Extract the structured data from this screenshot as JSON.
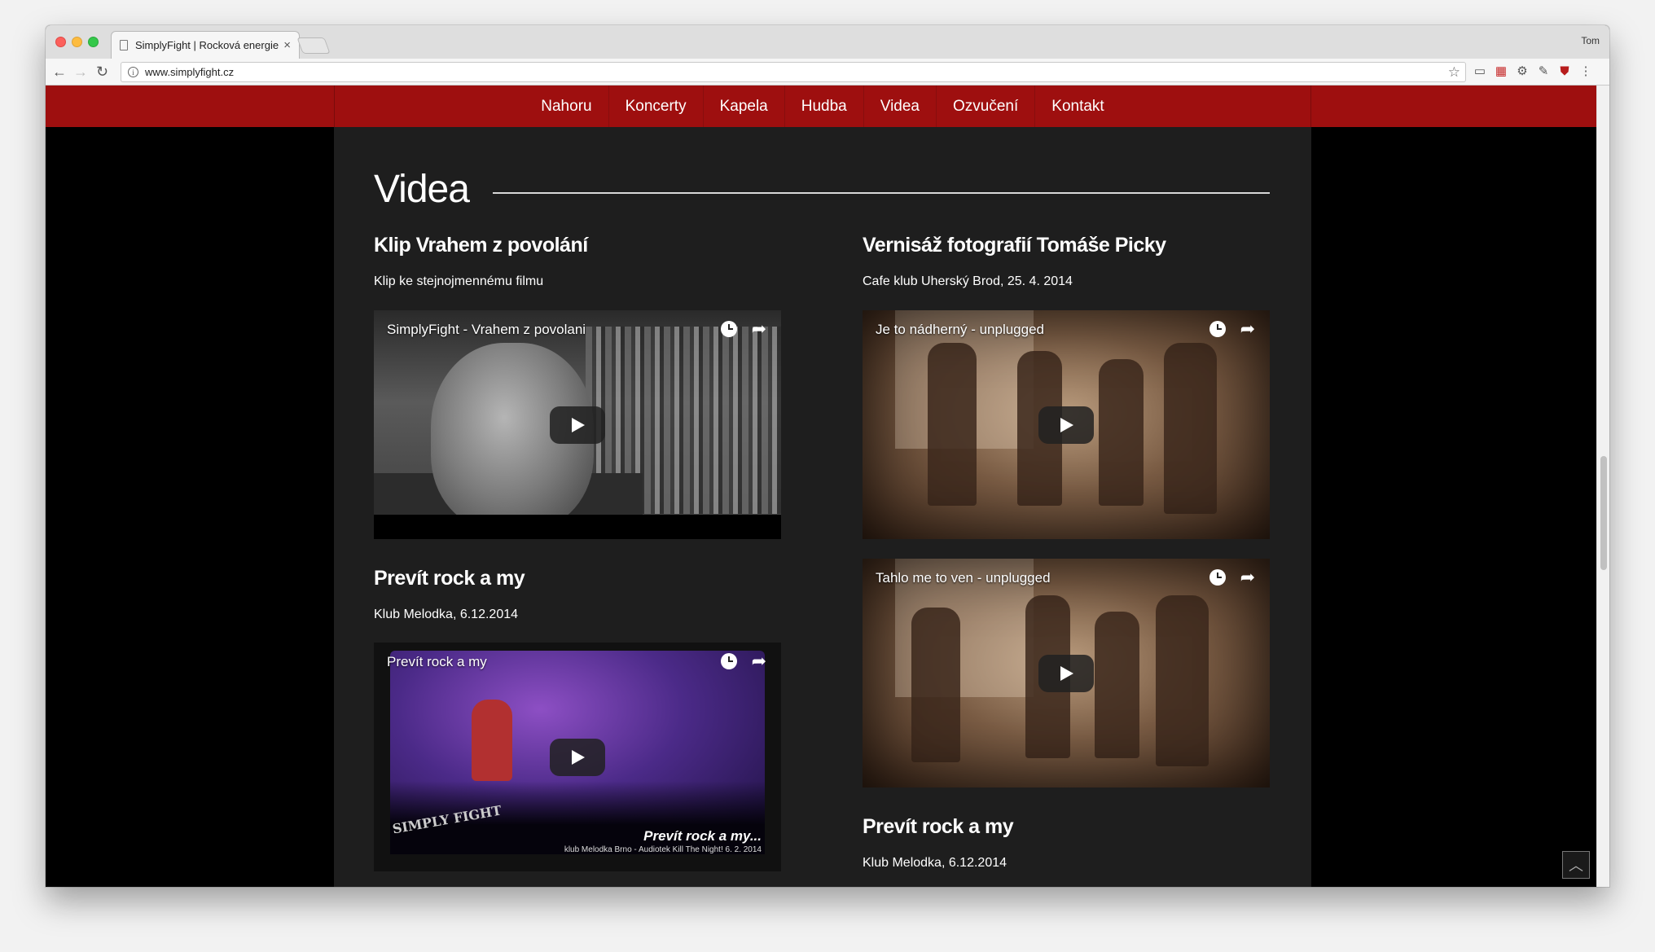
{
  "browser": {
    "tab_title": "SimplyFight | Rocková energie",
    "tab_close": "×",
    "profile_name": "Tom",
    "url": "www.simplyfight.cz",
    "icons": [
      "back-icon",
      "forward-icon",
      "reload-icon",
      "info-icon",
      "star-icon",
      "cast-icon",
      "calendar-icon",
      "settings-icon",
      "eyedropper-icon",
      "ublock-icon",
      "menu-icon"
    ]
  },
  "nav": {
    "items": [
      "Nahoru",
      "Koncerty",
      "Kapela",
      "Hudba",
      "Videa",
      "Ozvučení",
      "Kontakt"
    ],
    "accent": "#9e0f0f"
  },
  "section": {
    "title": "Videa"
  },
  "videos": {
    "left": [
      {
        "heading": "Klip Vrahem z povolání",
        "subheading": "Klip ke stejnojmennému filmu",
        "video_title": "SimplyFight - Vrahem z povolani"
      },
      {
        "heading": "Prevít rock a my",
        "subheading": "Klub Melodka, 6.12.2014",
        "video_title": "Prevít rock a my",
        "overlay_logo": "SIMPLY FIGHT",
        "overlay_caption": "Prevít rock a my...",
        "overlay_detail": "klub Melodka Brno - Audiotek Kill The Night!  6. 2. 2014"
      }
    ],
    "right": [
      {
        "heading": "Vernisáž fotografií Tomáše Picky",
        "subheading": "Cafe klub Uherský Brod, 25. 4. 2014",
        "video_title": "Je to nádherný - unplugged"
      },
      {
        "video_title": "Tahlo me to ven - unplugged"
      },
      {
        "heading": "Prevít rock a my",
        "subheading": "Klub Melodka, 6.12.2014"
      }
    ]
  },
  "scroll_top_icon": "chevron-up-icon"
}
